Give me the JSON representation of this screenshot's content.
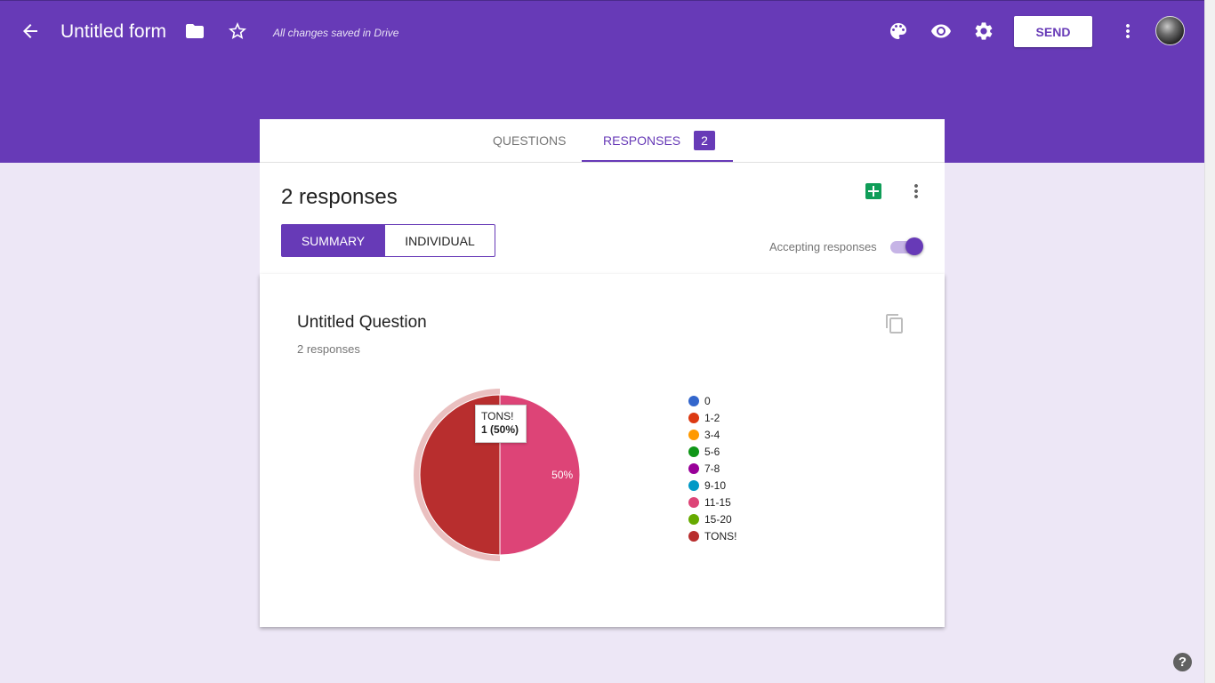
{
  "header": {
    "form_title": "Untitled form",
    "saved_status": "All changes saved in Drive",
    "send_label": "SEND",
    "icons": [
      "back-arrow-icon",
      "folder-icon",
      "star-icon",
      "palette-icon",
      "eye-icon",
      "gear-icon",
      "more-vert-icon",
      "avatar"
    ]
  },
  "tabs": {
    "questions": "QUESTIONS",
    "responses": "RESPONSES",
    "responses_count": "2",
    "active": "responses"
  },
  "responses": {
    "title": "2 responses",
    "summary_label": "SUMMARY",
    "individual_label": "INDIVIDUAL",
    "view_active": "summary",
    "accepting_label": "Accepting responses",
    "accepting": true
  },
  "question": {
    "title": "Untitled Question",
    "subtitle": "2 responses",
    "tooltip_label": "TONS!",
    "tooltip_value": "1 (50%)",
    "slice_label": "50%"
  },
  "chart_data": {
    "type": "pie",
    "categories": [
      "0",
      "1-2",
      "3-4",
      "5-6",
      "7-8",
      "9-10",
      "11-15",
      "15-20",
      "TONS!"
    ],
    "values": [
      0,
      0,
      0,
      0,
      0,
      0,
      1,
      0,
      1
    ],
    "colors": [
      "#3366cc",
      "#dc3912",
      "#ff9900",
      "#109618",
      "#990099",
      "#0099c6",
      "#dd4477",
      "#66aa00",
      "#b82e2e"
    ],
    "highlighted": "TONS!",
    "legend_position": "right"
  },
  "colors": {
    "accent": "#673ab7",
    "background": "#ede7f6"
  }
}
